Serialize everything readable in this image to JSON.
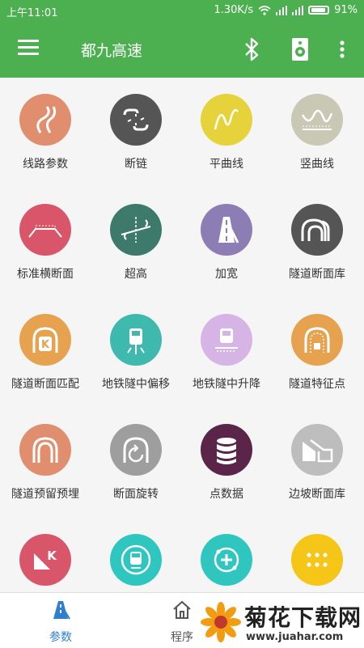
{
  "status_bar": {
    "time": "上午11:01",
    "speed": "1.30K/s",
    "battery": "91%"
  },
  "toolbar": {
    "title": "都九高速"
  },
  "grid_items": [
    {
      "label": "线路参数",
      "icon": "road-curve-icon",
      "color": "#e08e6d"
    },
    {
      "label": "断链",
      "icon": "broken-chain-icon",
      "color": "#555555"
    },
    {
      "label": "平曲线",
      "icon": "horizontal-curve-icon",
      "color": "#e6d23b"
    },
    {
      "label": "竖曲线",
      "icon": "vertical-curve-icon",
      "color": "#c8c8b4"
    },
    {
      "label": "标准横断面",
      "icon": "cross-section-icon",
      "color": "#d9556a"
    },
    {
      "label": "超高",
      "icon": "superelevation-icon",
      "color": "#3d7a6b"
    },
    {
      "label": "加宽",
      "icon": "widening-icon",
      "color": "#8d7db5"
    },
    {
      "label": "隧道断面库",
      "icon": "tunnel-library-icon",
      "color": "#555555"
    },
    {
      "label": "隧道断面匹配",
      "icon": "tunnel-match-icon",
      "color": "#e6a24f"
    },
    {
      "label": "地铁隧中偏移",
      "icon": "metro-offset-icon",
      "color": "#3fb8ad"
    },
    {
      "label": "地铁隧中升降",
      "icon": "metro-lift-icon",
      "color": "#d6b4e6"
    },
    {
      "label": "隧道特征点",
      "icon": "tunnel-feature-icon",
      "color": "#e6a24f"
    },
    {
      "label": "隧道预留预埋",
      "icon": "tunnel-reserve-icon",
      "color": "#e08e6d"
    },
    {
      "label": "断面旋转",
      "icon": "section-rotate-icon",
      "color": "#9e9e9e"
    },
    {
      "label": "点数据",
      "icon": "database-icon",
      "color": "#5a2548"
    },
    {
      "label": "边坡断面库",
      "icon": "slope-library-icon",
      "color": "#bdbdbd"
    },
    {
      "label": "",
      "icon": "slope-k-icon",
      "color": "#d9556a"
    },
    {
      "label": "",
      "icon": "train-icon",
      "color": "#2fc6c0"
    },
    {
      "label": "",
      "icon": "compass-plus-icon",
      "color": "#2fc6c0"
    },
    {
      "label": "",
      "icon": "grid-dots-icon",
      "color": "#f5c518"
    }
  ],
  "tabs": [
    {
      "label": "参数",
      "active": true,
      "color": "#2f7fd0"
    },
    {
      "label": "程序",
      "active": false,
      "color": "#555555"
    }
  ],
  "watermark": {
    "title": "菊花下载网",
    "url": "www.juahar.com"
  }
}
